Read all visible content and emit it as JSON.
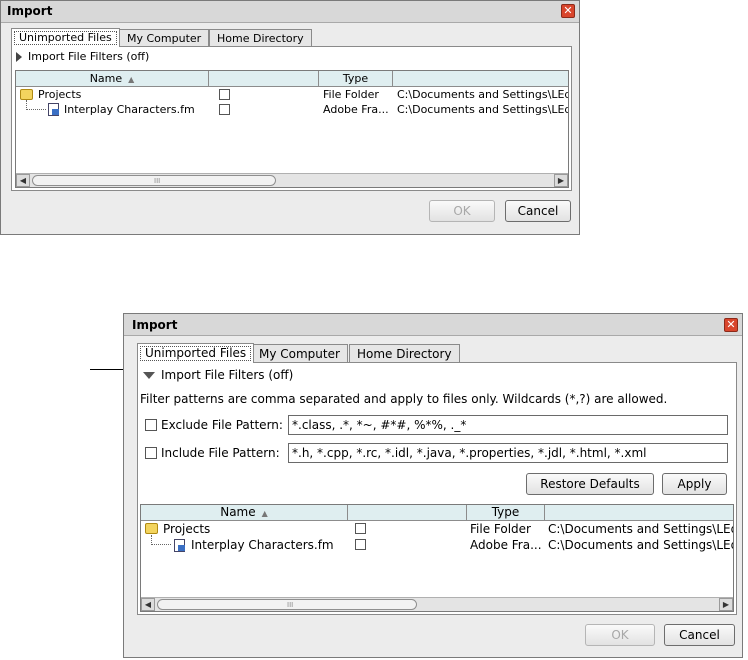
{
  "top_dialog": {
    "title": "Import",
    "close_glyph": "✕",
    "tabs": [
      "Unimported Files",
      "My Computer",
      "Home Directory"
    ],
    "filters_toggle": "Import File Filters (off)",
    "columns": [
      "Name",
      "",
      "Type",
      ""
    ],
    "sort_indicator": "▲",
    "rows": [
      {
        "name": "Projects",
        "type": "File Folder",
        "path": "C:\\Documents and Settings\\LEdv"
      },
      {
        "name": "Interplay Characters.fm",
        "type": "Adobe Fra...",
        "path": "C:\\Documents and Settings\\LEdv"
      }
    ],
    "scroll_left": "◀",
    "scroll_right": "▶",
    "scroll_grip": "III",
    "ok_label": "OK",
    "cancel_label": "Cancel"
  },
  "bottom_dialog": {
    "title": "Import",
    "close_glyph": "✕",
    "tabs": [
      "Unimported Files",
      "My Computer",
      "Home Directory"
    ],
    "filters_toggle": "Import File Filters (off)",
    "filter_hint": "Filter patterns are comma separated and apply to files only. Wildcards (*,?) are allowed.",
    "exclude_label": "Exclude File Pattern:",
    "exclude_value": "*.class, .*, *~, #*#, %*%, ._*",
    "include_label": "Include File Pattern:",
    "include_value": "*.h, *.cpp, *.rc, *.idl, *.java, *.properties, *.jdl, *.html, *.xml",
    "restore_label": "Restore Defaults",
    "apply_label": "Apply",
    "columns": [
      "Name",
      "",
      "Type",
      ""
    ],
    "sort_indicator": "▲",
    "rows": [
      {
        "name": "Projects",
        "type": "File Folder",
        "path": "C:\\Documents and Settings\\LEdv"
      },
      {
        "name": "Interplay Characters.fm",
        "type": "Adobe Fra...",
        "path": "C:\\Documents and Settings\\LEdv"
      }
    ],
    "scroll_left": "◀",
    "scroll_right": "▶",
    "scroll_grip": "III",
    "ok_label": "OK",
    "cancel_label": "Cancel"
  }
}
